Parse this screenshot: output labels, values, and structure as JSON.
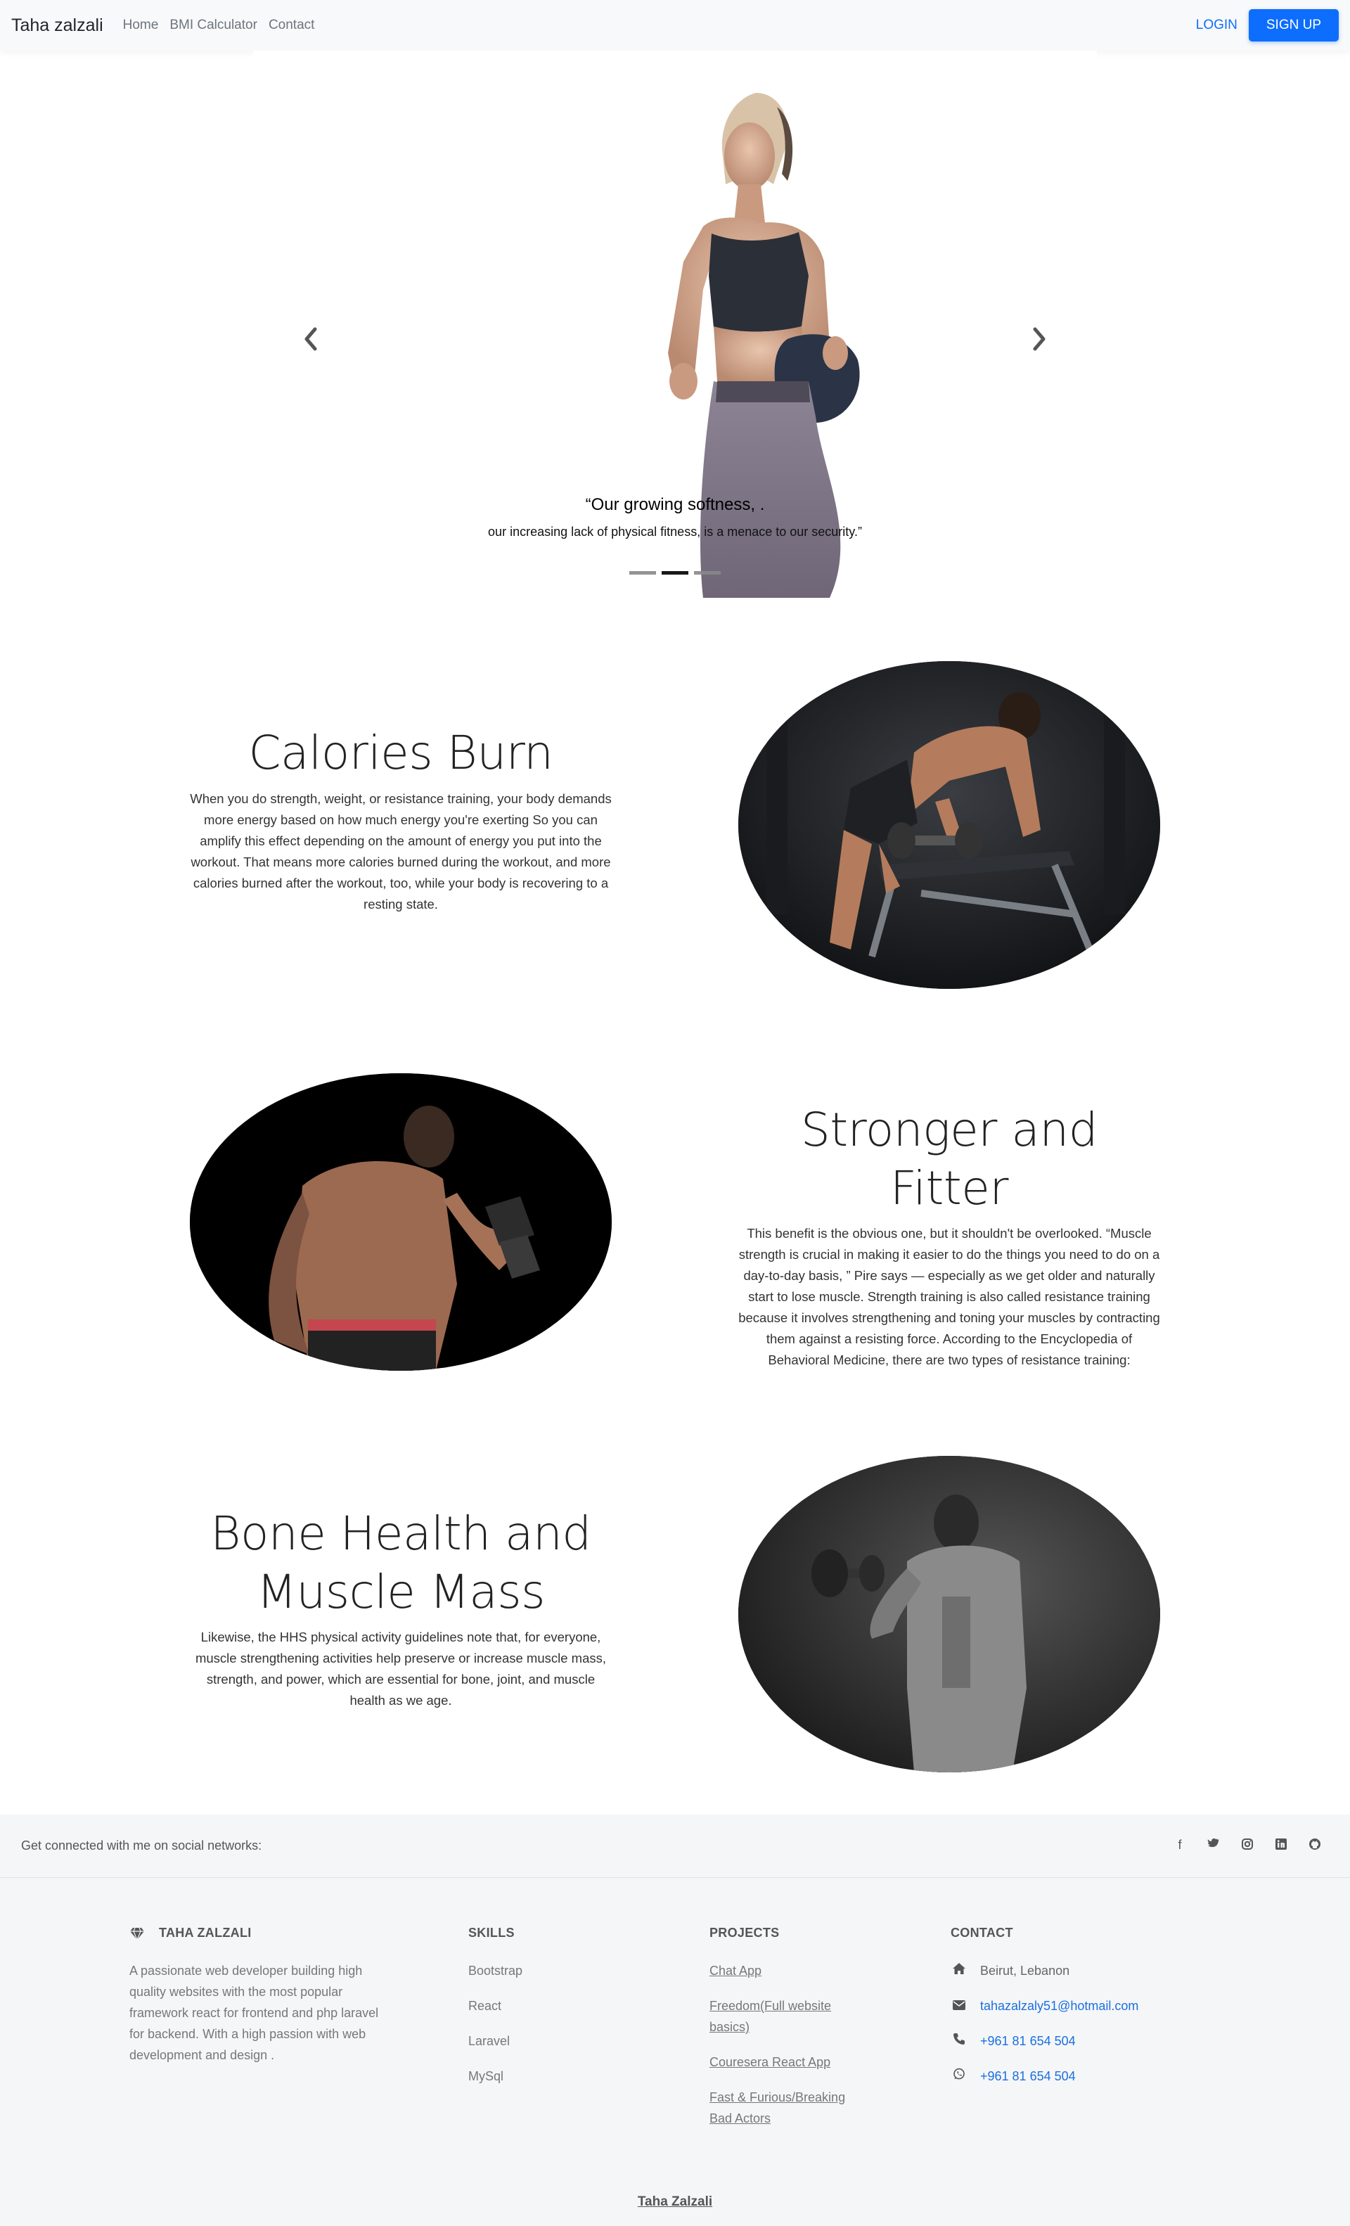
{
  "navbar": {
    "brand": "Taha zalzali",
    "links": [
      "Home",
      "BMI Calculator",
      "Contact"
    ],
    "login_label": "LOGIN",
    "signup_label": "SIGN UP"
  },
  "carousel": {
    "caption_title": "“Our growing softness, .",
    "caption_text": "our increasing lack of physical fitness, is a menace to our security.”",
    "slide_count": 3,
    "active_slide": 2
  },
  "features": [
    {
      "title": "Calories Burn",
      "body": "When you do strength, weight, or resistance training, your body demands more energy based on how much energy you're exerting So you can amplify this effect depending on the amount of energy you put into the workout. That means more calories burned during the workout, and more calories burned after the workout, too, while your body is recovering to a resting state."
    },
    {
      "title": "Stronger and Fitter",
      "body": "This benefit is the obvious one, but it shouldn't be overlooked. “Muscle strength is crucial in making it easier to do the things you need to do on a day-to-day basis, ” Pire says — especially as we get older and naturally start to lose muscle. Strength training is also called resistance training because it involves strengthening and toning your muscles by contracting them against a resisting force. According to the Encyclopedia of Behavioral Medicine, there are two types of resistance training:"
    },
    {
      "title": "Bone Health and Muscle Mass",
      "body": "Likewise, the HHS physical activity guidelines note that, for everyone, muscle strengthening activities help preserve or increase muscle mass, strength, and power, which are essential for bone, joint, and muscle health as we age."
    }
  ],
  "footer": {
    "social_text": "Get connected with me on social networks:",
    "social_icons": [
      "facebook-icon",
      "twitter-icon",
      "instagram-icon",
      "linkedin-icon",
      "github-icon"
    ],
    "about": {
      "title": "TAHA ZALZALI",
      "text": "A passionate web developer building high quality websites with the most popular framework react for frontend and php laravel for backend. With a high passion with web development and design ."
    },
    "skills": {
      "title": "SKILLS",
      "items": [
        "Bootstrap",
        "React",
        "Laravel",
        "MySql"
      ]
    },
    "projects": {
      "title": "PROJECTS",
      "items": [
        "Chat App",
        "Freedom(Full website basics)",
        "Couresera React App",
        "Fast & Furious/Breaking Bad Actors"
      ]
    },
    "contact": {
      "title": "CONTACT",
      "address": "Beirut, Lebanon",
      "email": "tahazalzaly51@hotmail.com",
      "phone": "+961 81 654 504",
      "whatsapp": "+961 81 654 504"
    },
    "copyright": "Taha Zalzali"
  },
  "colors": {
    "primary": "#0d6efd",
    "navbar_bg": "#f8f9fa",
    "footer_bg": "#f5f6f8",
    "link_blue": "#1b6fe0"
  }
}
